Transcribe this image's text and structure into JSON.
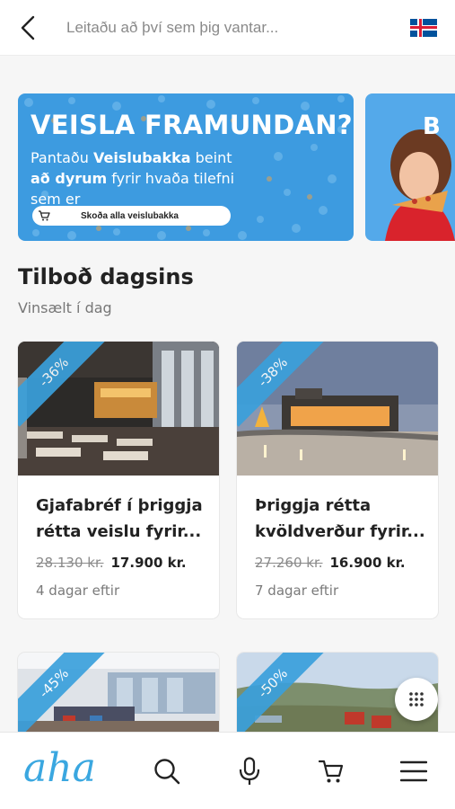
{
  "header": {
    "search_placeholder": "Leitaðu að því sem þig vantar...",
    "back_icon": "chevron-left-icon",
    "language_flag": "iceland-flag-icon"
  },
  "banner": {
    "title": "VEISLA FRAMUNDAN?",
    "subtitle_parts": [
      "Pantaðu ",
      "Veislubakka",
      " beint ",
      "að dyrum",
      " fyrir hvaða tilefni sem er"
    ],
    "button_label": "Skoða alla veislubakka",
    "second_banner_letter": "B",
    "background_color": "#3d9be0"
  },
  "section": {
    "title": "Tilboð dagsins",
    "subtitle": "Vinsælt í dag"
  },
  "deals": [
    {
      "discount": "-36%",
      "title": "Gjafabréf í þriggja réttа veislu fyrir...",
      "old_price": "28.130 kr.",
      "new_price": "17.900 kr.",
      "days_left": "4 dagar eftir"
    },
    {
      "discount": "-38%",
      "title": "Þriggja rétta kvöldverður fyrir...",
      "old_price": "27.260 kr.",
      "new_price": "16.900 kr.",
      "days_left": "7 dagar eftir"
    },
    {
      "discount": "-45%"
    },
    {
      "discount": "-50%"
    }
  ],
  "bottom_nav": {
    "logo": "aha",
    "items": [
      "search-icon",
      "microphone-icon",
      "cart-icon",
      "menu-icon"
    ]
  },
  "colors": {
    "accent": "#3aa7e0",
    "ribbon": "#3aa0dc"
  }
}
